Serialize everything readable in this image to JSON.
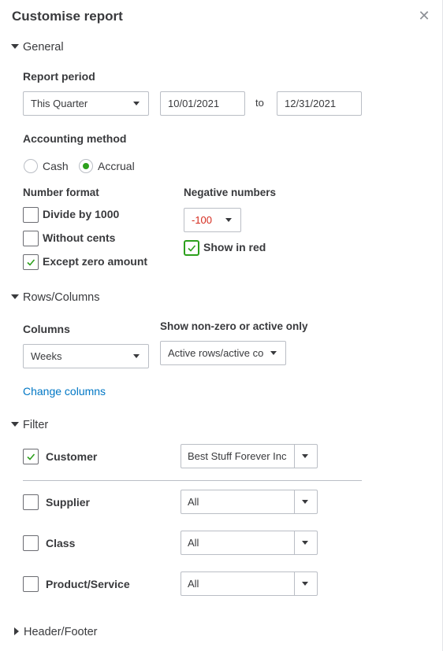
{
  "header": {
    "title": "Customise report",
    "close_icon": "close-icon"
  },
  "general": {
    "section_label": "General",
    "report_period": {
      "label": "Report period",
      "selected": "This Quarter",
      "from": "10/01/2021",
      "to_label": "to",
      "to": "12/31/2021"
    },
    "accounting_method": {
      "label": "Accounting method",
      "options": [
        "Cash",
        "Accrual"
      ],
      "selected": "Accrual"
    },
    "number_format": {
      "label": "Number format",
      "options": [
        {
          "label": "Divide by 1000",
          "checked": false
        },
        {
          "label": "Without cents",
          "checked": false
        },
        {
          "label": "Except zero amount",
          "checked": true
        }
      ]
    },
    "negative_numbers": {
      "label": "Negative numbers",
      "selected": "-100",
      "show_in_red_label": "Show in red",
      "show_in_red_checked": true,
      "negative_color": "#d52b1e"
    }
  },
  "rows_columns": {
    "section_label": "Rows/Columns",
    "columns_label": "Columns",
    "columns_selected": "Weeks",
    "show_label": "Show non-zero or active only",
    "show_selected": "Active rows/active co",
    "change_columns_link": "Change columns"
  },
  "filter": {
    "section_label": "Filter",
    "items": [
      {
        "label": "Customer",
        "checked": true,
        "value": "Best Stuff Forever Inc"
      },
      {
        "label": "Supplier",
        "checked": false,
        "value": "All"
      },
      {
        "label": "Class",
        "checked": false,
        "value": "All"
      },
      {
        "label": "Product/Service",
        "checked": false,
        "value": "All"
      }
    ]
  },
  "header_footer": {
    "section_label": "Header/Footer"
  },
  "colors": {
    "accent_green": "#2ca01c",
    "link_blue": "#0077c5",
    "text": "#393a3d",
    "border": "#babec5"
  }
}
